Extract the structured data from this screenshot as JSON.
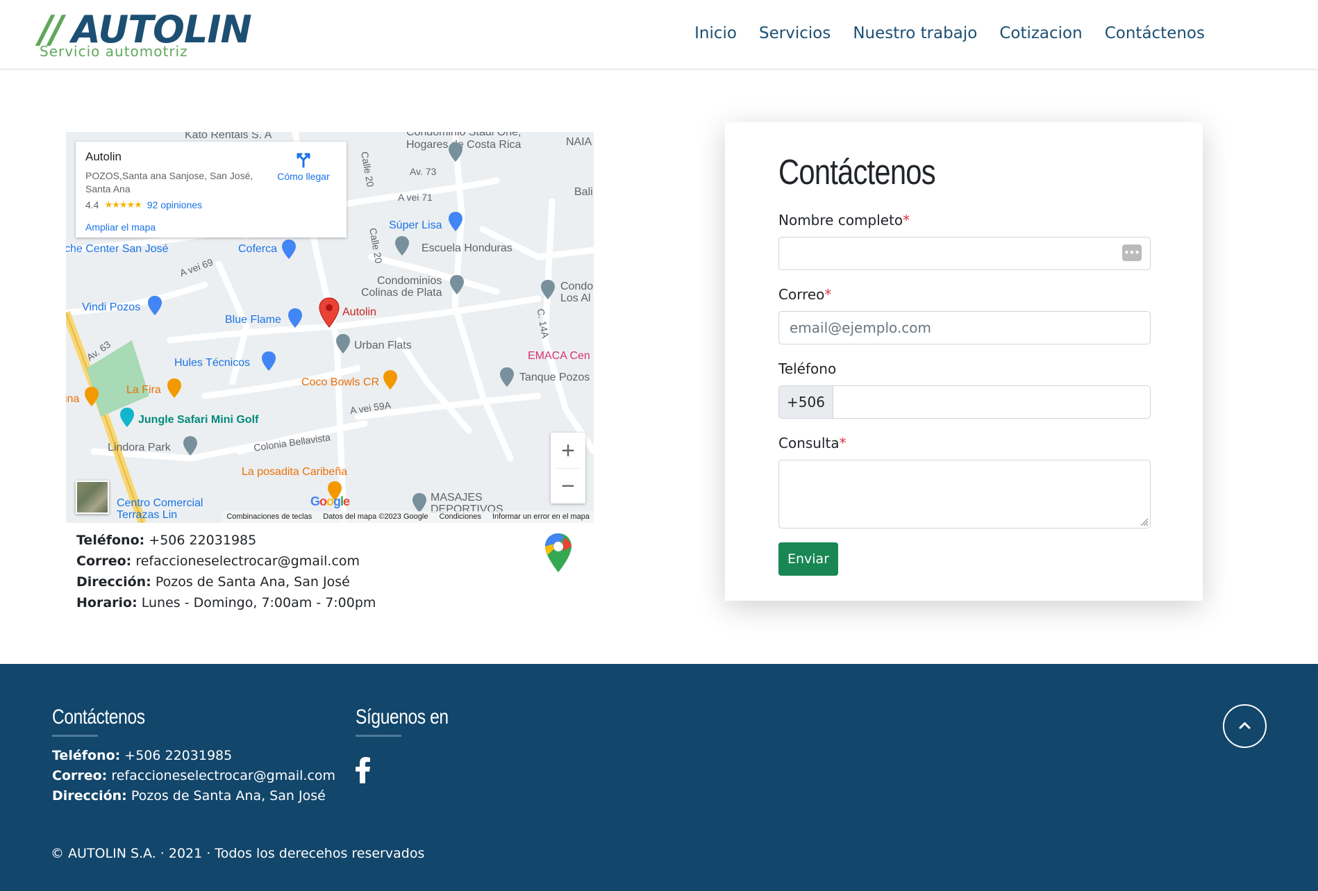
{
  "logo": {
    "mark": "//",
    "name": "AUTOLIN",
    "tagline": "Servicio automotriz"
  },
  "nav": [
    "Inicio",
    "Servicios",
    "Nuestro trabajo",
    "Cotizacion",
    "Contáctenos"
  ],
  "map": {
    "card": {
      "title": "Autolin",
      "address": "POZOS,Santa ana Sanjose, San José, Santa Ana",
      "rating": "4.4",
      "stars": "★★★★★",
      "reviews": "92 opiniones",
      "expand": "Ampliar el mapa",
      "directions": "Cómo llegar"
    },
    "labels": [
      "Kato Rentals S. A",
      "Condominio Stadi One, Hogares de Costa Rica",
      "NAIA",
      "Av. 73",
      "A vei 71",
      "Bali",
      "Calle 20",
      "Súper Lisa",
      "Escuela Honduras",
      "che Center San José",
      "Coferса",
      "A vei 69",
      "Calle 20",
      "Condominios",
      "Colinas de Plata",
      "Condo",
      "Los Al",
      "Vindi Pozos",
      "Blue Flame",
      "Autolin",
      "C. 14A",
      "Urban Flats",
      "Av. 63",
      "Hules Técnicos",
      "EMACA Cen",
      "Tanque Pozos",
      "La Fira",
      "ina",
      "Coco Bowls CR",
      "A vei 59A",
      "Jungle Safari Mini Golf",
      "Colonia Bellavista",
      "Lindora Park",
      "La posadita Caribeña",
      "Centro Comercial",
      "Terrazas Lin",
      "MASAJES",
      "DEPORTIVOS"
    ],
    "attribution": [
      "Combinaciones de teclas",
      "Datos del mapa ©2023 Google",
      "Condiciones",
      "Informar un error en el mapa"
    ],
    "google": "Google",
    "zoom_in": "+",
    "zoom_out": "−"
  },
  "contact": {
    "phone_label": "Teléfono:",
    "phone": "+506 22031985",
    "email_label": "Correo:",
    "email": "refaccioneselectrocar@gmail.com",
    "address_label": "Dirección:",
    "address": "Pozos de Santa Ana, San José",
    "hours_label": "Horario:",
    "hours": "Lunes - Domingo, 7:00am - 7:00pm"
  },
  "form": {
    "title": "Contáctenos",
    "name_label": "Nombre completo",
    "email_label": "Correo",
    "email_placeholder": "email@ejemplo.com",
    "phone_label": "Teléfono",
    "phone_prefix": "+506",
    "query_label": "Consulta",
    "required": "*",
    "submit": "Enviar",
    "autofill": "•••"
  },
  "footer": {
    "contact_title": "Contáctenos",
    "follow_title": "Síguenos en",
    "phone_label": "Teléfono:",
    "phone": "+506 22031985",
    "email_label": "Correo:",
    "email": "refaccioneselectrocar@gmail.com",
    "address_label": "Dirección:",
    "address": "Pozos de Santa Ana, San José",
    "copyright": "© AUTOLIN S.A. · 2021 · Todos los derecehos reservados"
  },
  "colors": {
    "brand": "#1d4f73",
    "accent": "#5fa85a",
    "footer": "#12466b",
    "submit": "#198754"
  },
  "icons": [
    "facebook-icon",
    "chevron-up-icon",
    "google-maps-icon",
    "directions-icon",
    "map-pin-icon"
  ]
}
